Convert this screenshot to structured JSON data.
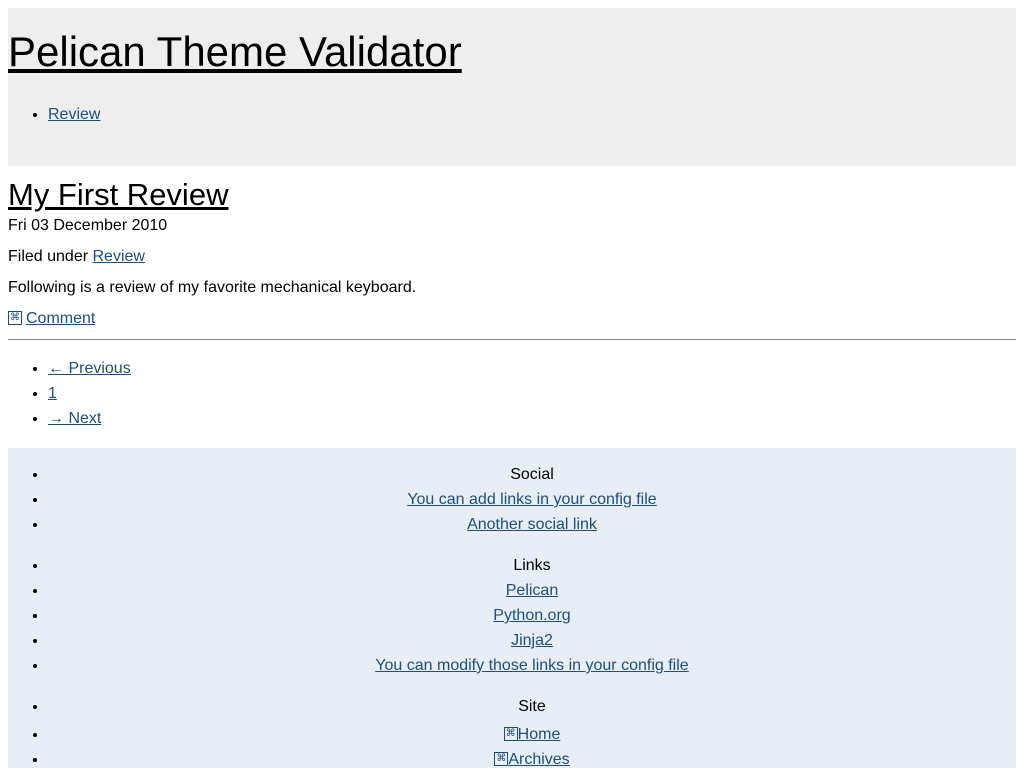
{
  "header": {
    "site_title": "Pelican Theme Validator",
    "menu": [
      {
        "label": "Review"
      }
    ]
  },
  "article": {
    "title": "My First Review",
    "date": "Fri 03 December 2010",
    "filed_prefix": "Filed under",
    "category": "Review",
    "summary": "Following is a review of my favorite mechanical keyboard.",
    "comment_label": "Comment",
    "comment_icon": "comment-icon"
  },
  "pagination": {
    "previous": "← Previous",
    "page": "1",
    "next": "→ Next"
  },
  "footer": {
    "social": {
      "heading": "Social",
      "links": [
        "You can add links in your config file",
        "Another social link"
      ]
    },
    "links": {
      "heading": "Links",
      "items": [
        "Pelican",
        "Python.org",
        "Jinja2",
        "You can modify those links in your config file"
      ]
    },
    "site": {
      "heading": "Site",
      "items": [
        {
          "label": "Home",
          "icon": "home-icon"
        },
        {
          "label": "Archives",
          "icon": "archives-icon"
        }
      ]
    }
  },
  "colors": {
    "header_bg": "#eeeeee",
    "footer_bg": "#e8eef5",
    "link": "#1f4e79"
  }
}
